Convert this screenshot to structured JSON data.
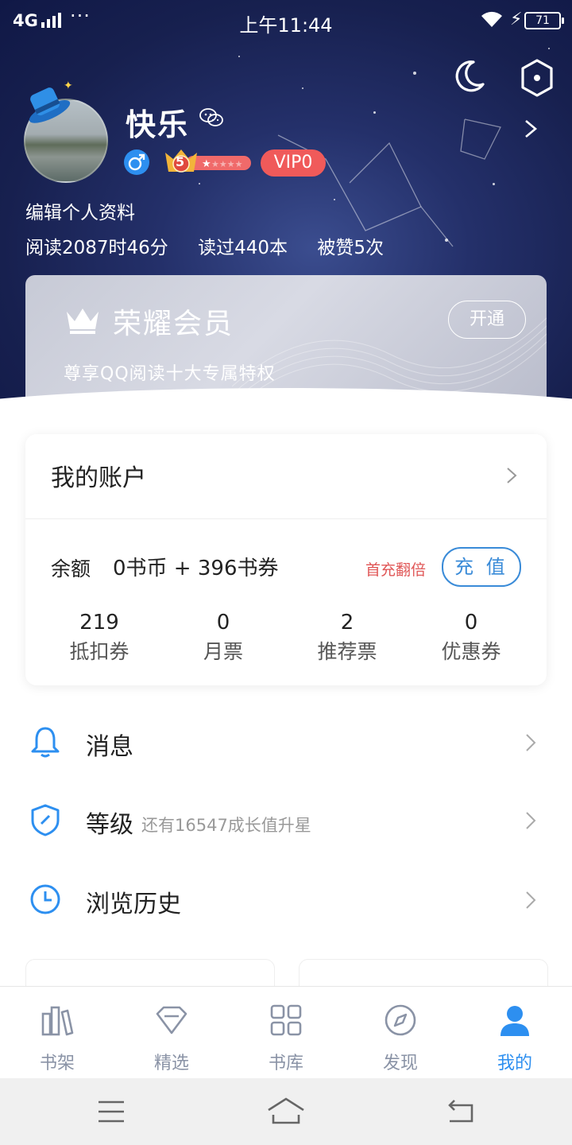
{
  "status_bar": {
    "network": "4G",
    "dots": "···",
    "time": "上午11:44",
    "battery": "71"
  },
  "profile": {
    "username": "快乐",
    "vip": "VIP0",
    "level": "5",
    "edit_label": "编辑个人资料",
    "stats": [
      "阅读2087时46分",
      "读过440本",
      "被赞5次"
    ]
  },
  "member_card": {
    "title": "荣耀会员",
    "subtitle": "尊享QQ阅读十大专属特权",
    "open_label": "开通"
  },
  "account": {
    "title": "我的账户",
    "balance_label": "余额",
    "balance_value": "0书币 + 396书券",
    "first_charge": "首充翻倍",
    "recharge_label": "充 值",
    "tickets": [
      {
        "value": "219",
        "label": "抵扣券"
      },
      {
        "value": "0",
        "label": "月票"
      },
      {
        "value": "2",
        "label": "推荐票"
      },
      {
        "value": "0",
        "label": "优惠券"
      }
    ]
  },
  "menu": [
    {
      "label": "消息",
      "icon": "bell-icon"
    },
    {
      "label": "等级",
      "sub": "还有16547成长值升星",
      "icon": "shield-icon"
    },
    {
      "label": "浏览历史",
      "icon": "clock-icon"
    }
  ],
  "tabs": [
    {
      "label": "书架",
      "icon": "bookshelf-icon"
    },
    {
      "label": "精选",
      "icon": "diamond-icon"
    },
    {
      "label": "书库",
      "icon": "grid-icon"
    },
    {
      "label": "发现",
      "icon": "compass-icon"
    },
    {
      "label": "我的",
      "icon": "person-icon",
      "active": true
    }
  ],
  "colors": {
    "accent": "#2d8ff0",
    "vip_badge": "#f05a5a",
    "first_charge": "#e05656",
    "header_bg": "#1a2356"
  }
}
